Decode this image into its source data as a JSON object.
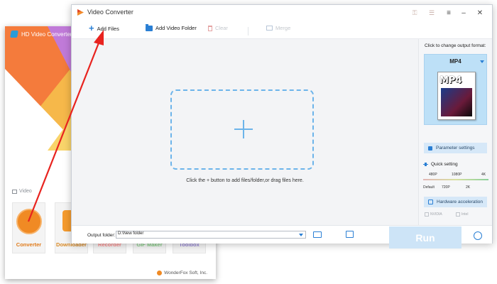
{
  "background_window": {
    "title": "HD Video Converter F",
    "section_label": "Video",
    "tools": [
      {
        "label": "Converter"
      },
      {
        "label": "Downloader"
      },
      {
        "label": "Recorder"
      },
      {
        "label": "GIF Maker"
      },
      {
        "label": "Toolbox"
      }
    ],
    "footer": "WonderFox Soft, Inc."
  },
  "main_window": {
    "title": "Video Converter",
    "toolbar": {
      "add_files": "Add Files",
      "add_video_folder": "Add Video Folder",
      "clear": "Clear",
      "merge": "Merge"
    },
    "drop_hint": "Click the + button to add files/folder,or drag files here.",
    "right_panel": {
      "header": "Click to change output format:",
      "format": "MP4",
      "format_badge": "MP4",
      "parameter_settings": "Parameter settings",
      "quick_setting": "Quick setting",
      "quality_top": [
        "480P",
        "1080P",
        "4K"
      ],
      "quality_bottom": [
        "Default",
        "720P",
        "2K"
      ],
      "hardware_acceleration": "Hardware acceleration",
      "gpu_nvidia": "NVIDIA",
      "gpu_intel": "Intel"
    },
    "bottom": {
      "output_folder_label": "Output folder:",
      "output_folder_value": "D:\\New folder",
      "run": "Run"
    }
  },
  "colors": {
    "accent": "#2a7fd4",
    "dropzone": "#6cb4ea",
    "run_button": "#cde4f7",
    "annotation_arrow": "#e8231f"
  }
}
